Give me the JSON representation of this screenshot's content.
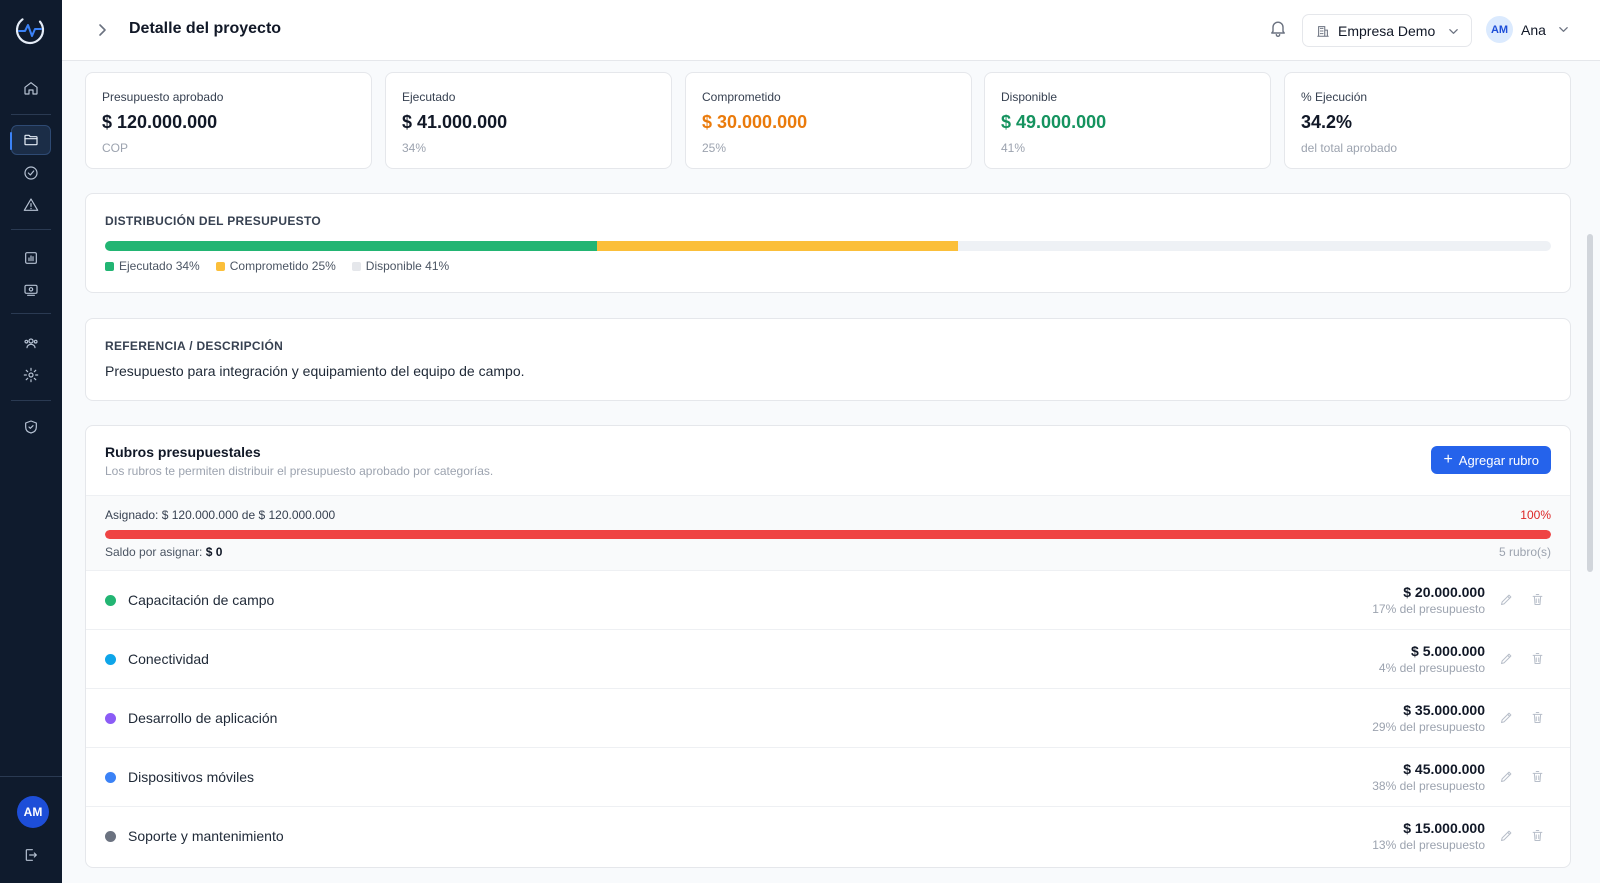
{
  "header": {
    "title": "Detalle del proyecto",
    "company": "Empresa Demo",
    "user_initials": "AM",
    "user_name": "Ana"
  },
  "sidebar": {
    "avatar_initials": "AM",
    "items": [
      {
        "name": "home-icon"
      },
      {
        "name": "folder-icon",
        "active": true
      },
      {
        "name": "check-circle-icon"
      },
      {
        "name": "alert-triangle-icon"
      },
      {
        "name": "bar-chart-icon"
      },
      {
        "name": "money-icon"
      },
      {
        "name": "users-icon"
      },
      {
        "name": "settings-icon"
      },
      {
        "name": "shield-check-icon"
      },
      {
        "name": "logout-icon"
      }
    ]
  },
  "stats": [
    {
      "label": "Presupuesto aprobado",
      "value": "$ 120.000.000",
      "sub": "COP",
      "color": "#111827"
    },
    {
      "label": "Ejecutado",
      "value": "$ 41.000.000",
      "sub": "34%",
      "color": "#111827"
    },
    {
      "label": "Comprometido",
      "value": "$ 30.000.000",
      "sub": "25%",
      "color": "#ea7b0c"
    },
    {
      "label": "Disponible",
      "value": "$ 49.000.000",
      "sub": "41%",
      "color": "#15935f"
    },
    {
      "label": "% Ejecución",
      "value": "34.2%",
      "sub": "del total aprobado",
      "color": "#111827"
    }
  ],
  "distribution": {
    "title": "DISTRIBUCIÓN DEL PRESUPUESTO",
    "segments": [
      {
        "label": "Ejecutado 34%",
        "fraction": 0.34,
        "color": "#22b573"
      },
      {
        "label": "Comprometido 25%",
        "fraction": 0.25,
        "color": "#fbbf3a"
      },
      {
        "label": "Disponible 41%",
        "fraction": 0.41,
        "color": "#e5e7eb"
      }
    ]
  },
  "reference": {
    "title": "REFERENCIA / DESCRIPCIÓN",
    "text": "Presupuesto para integración y equipamiento del equipo de campo."
  },
  "rubros": {
    "title": "Rubros presupuestales",
    "subtitle": "Los rubros te permiten distribuir el presupuesto aprobado por categorías.",
    "add_label": "Agregar rubro",
    "assigned_text": "Asignado: $ 120.000.000 de $ 120.000.000",
    "assigned_pct": "100%",
    "assigned_fraction": 1.0,
    "saldo_label": "Saldo por asignar:",
    "saldo_value": "$ 0",
    "count": "5 rubro(s)",
    "items": [
      {
        "name": "Capacitación de campo",
        "amount": "$ 20.000.000",
        "pct": "17% del presupuesto",
        "color": "#22b573"
      },
      {
        "name": "Conectividad",
        "amount": "$ 5.000.000",
        "pct": "4% del presupuesto",
        "color": "#0ea5e9"
      },
      {
        "name": "Desarrollo de aplicación",
        "amount": "$ 35.000.000",
        "pct": "29% del presupuesto",
        "color": "#8b5cf6"
      },
      {
        "name": "Dispositivos móviles",
        "amount": "$ 45.000.000",
        "pct": "38% del presupuesto",
        "color": "#3b82f6"
      },
      {
        "name": "Soporte y mantenimiento",
        "amount": "$ 15.000.000",
        "pct": "13% del presupuesto",
        "color": "#6b7280"
      }
    ]
  }
}
